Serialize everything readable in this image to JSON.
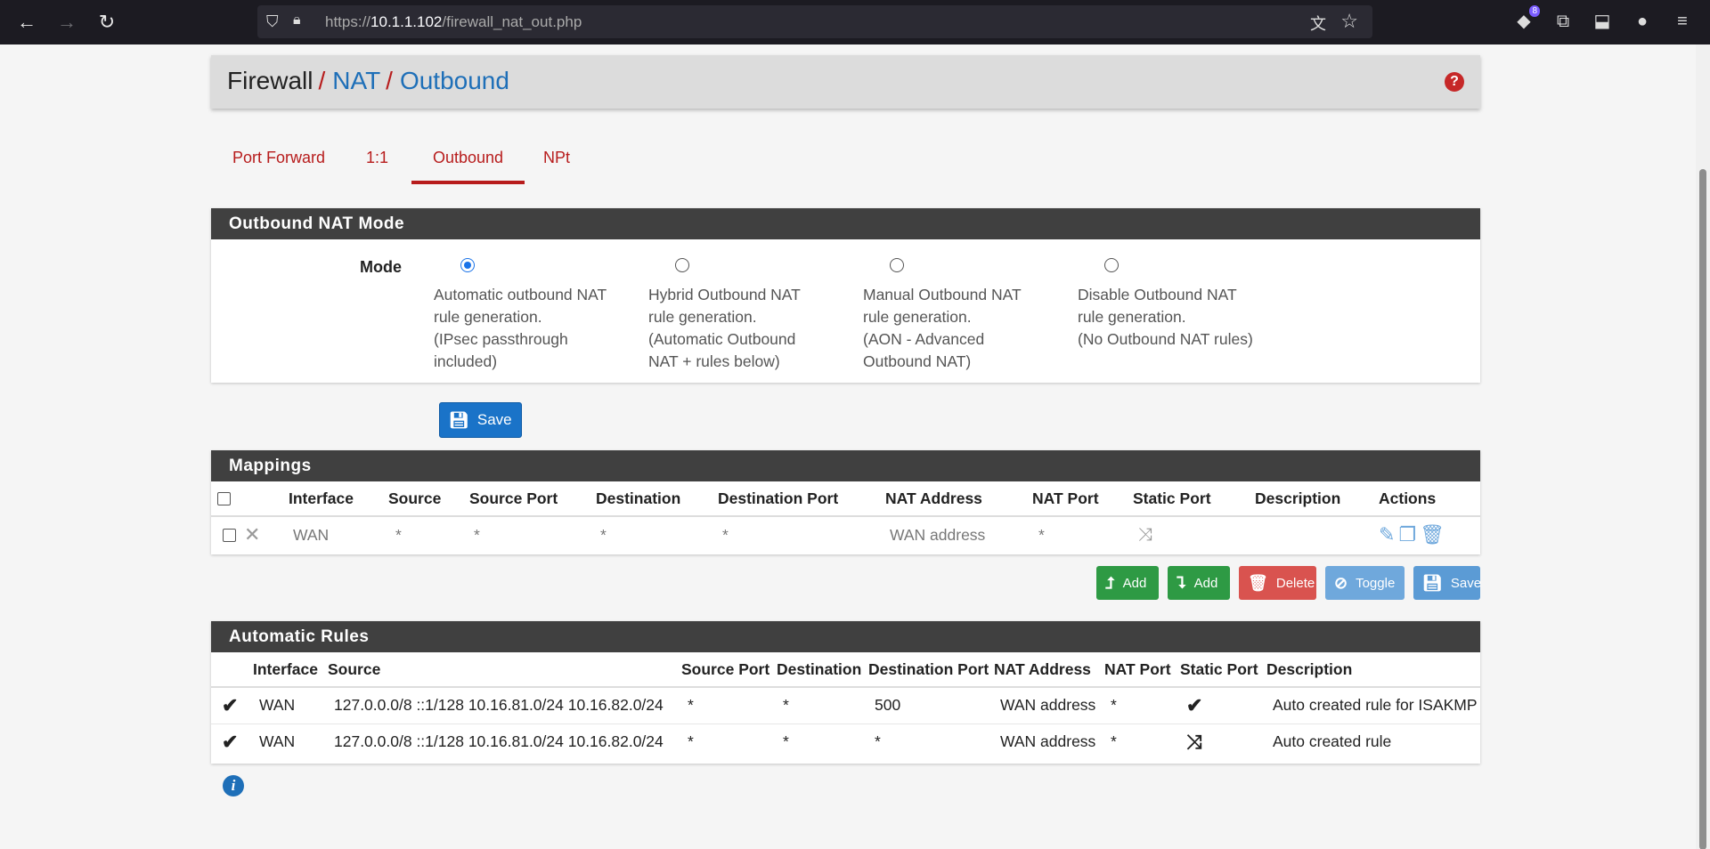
{
  "browser": {
    "url_prefix": "https://",
    "url_host": "10.1.1.102",
    "url_path": "/firewall_nat_out.php",
    "ext_badge": "8"
  },
  "breadcrumb": {
    "root": "Firewall",
    "sep1": "/",
    "nat": "NAT",
    "sep2": "/",
    "current": "Outbound",
    "help": "?"
  },
  "tabs": [
    {
      "label": "Port Forward"
    },
    {
      "label": "1:1"
    },
    {
      "label": "Outbound"
    },
    {
      "label": "NPt"
    }
  ],
  "mode_panel": {
    "title": "Outbound NAT Mode",
    "label": "Mode",
    "selected": "Automatic",
    "options": [
      {
        "lines": [
          "Automatic outbound NAT",
          "rule generation.",
          "(IPsec passthrough",
          "included)"
        ]
      },
      {
        "lines": [
          "Hybrid Outbound NAT",
          "rule generation.",
          "(Automatic Outbound",
          "NAT + rules below)"
        ]
      },
      {
        "lines": [
          "Manual Outbound NAT",
          "rule generation.",
          "(AON - Advanced",
          "Outbound NAT)"
        ]
      },
      {
        "lines": [
          "Disable Outbound NAT",
          "rule generation.",
          "(No Outbound NAT rules)"
        ]
      }
    ],
    "save_label": "Save"
  },
  "mappings": {
    "title": "Mappings",
    "columns": [
      "Interface",
      "Source",
      "Source Port",
      "Destination",
      "Destination Port",
      "NAT Address",
      "NAT Port",
      "Static Port",
      "Description",
      "Actions"
    ],
    "rows": [
      {
        "interface": "WAN",
        "source": "*",
        "source_port": "*",
        "destination": "*",
        "destination_port": "*",
        "nat_address": "WAN address",
        "nat_port": "*",
        "description": ""
      }
    ],
    "buttons": {
      "add_top": "Add",
      "add_bottom": "Add",
      "delete": "Delete",
      "toggle": "Toggle",
      "save": "Save"
    }
  },
  "automatic_rules": {
    "title": "Automatic Rules",
    "columns": [
      "Interface",
      "Source",
      "Source Port",
      "Destination",
      "Destination Port",
      "NAT Address",
      "NAT Port",
      "Static Port",
      "Description"
    ],
    "rows": [
      {
        "interface": "WAN",
        "source": "127.0.0.0/8 ::1/128 10.16.81.0/24 10.16.82.0/24",
        "source_port": "*",
        "destination": "*",
        "destination_port": "500",
        "nat_address": "WAN address",
        "nat_port": "*",
        "static_port": "check-icon",
        "description": "Auto created rule for ISAKMP"
      },
      {
        "interface": "WAN",
        "source": "127.0.0.0/8 ::1/128 10.16.81.0/24 10.16.82.0/24",
        "source_port": "*",
        "destination": "*",
        "destination_port": "*",
        "nat_address": "WAN address",
        "nat_port": "*",
        "static_port": "random-icon",
        "description": "Auto created rule"
      }
    ]
  },
  "colors": {
    "accent_red": "#b71c1c",
    "link_blue": "#1e6fb8",
    "panel_header": "#404040"
  }
}
